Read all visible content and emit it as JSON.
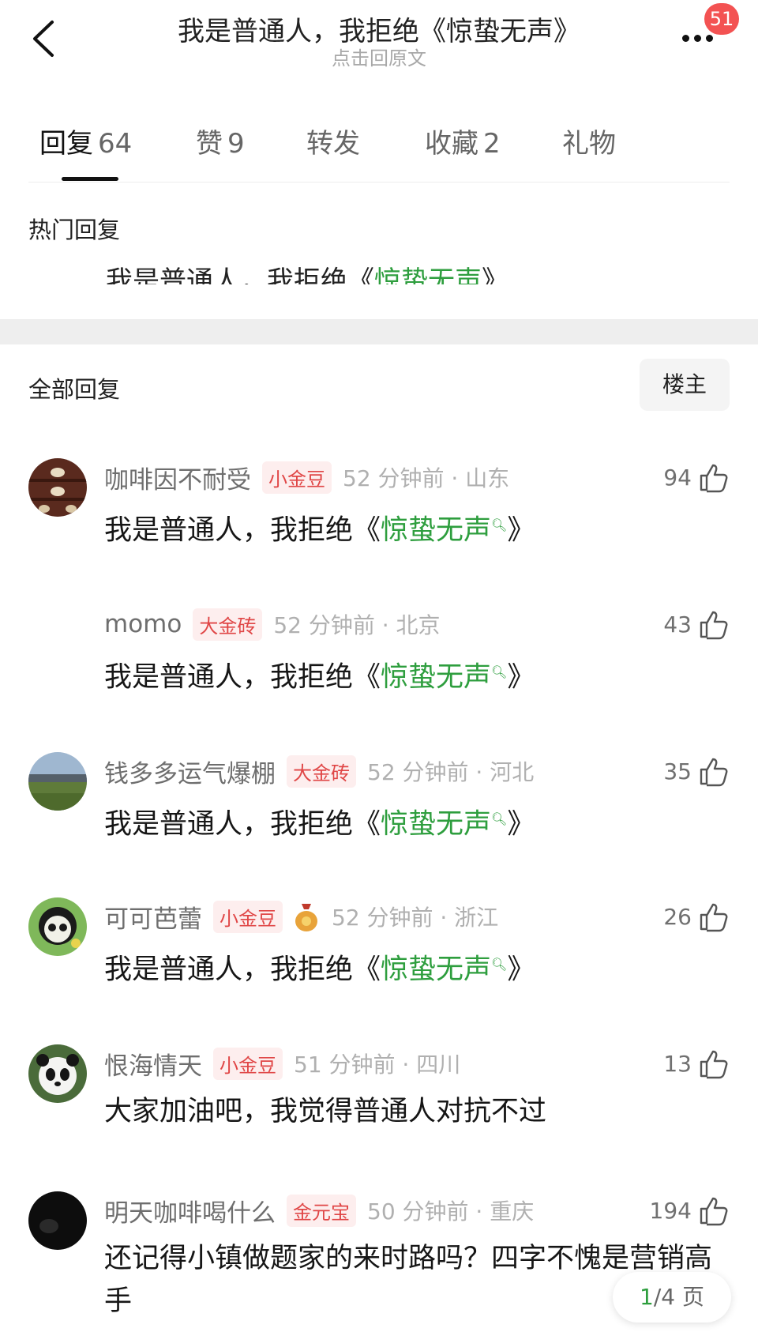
{
  "header": {
    "title": "我是普通人，我拒绝《惊蛰无声》",
    "subtitle": "点击回原文",
    "badge": "51"
  },
  "tabs": [
    {
      "label": "回复",
      "count": "64",
      "active": true
    },
    {
      "label": "赞",
      "count": "9",
      "active": false
    },
    {
      "label": "转发",
      "count": "",
      "active": false
    },
    {
      "label": "收藏",
      "count": "2",
      "active": false
    },
    {
      "label": "礼物",
      "count": "",
      "active": false
    }
  ],
  "hot": {
    "title": "热门回复",
    "preview_prefix": "我是普通人，我拒绝《",
    "preview_link": "惊蛰无声",
    "preview_suffix": "》"
  },
  "all": {
    "title": "全部回复",
    "owner_button": "楼主"
  },
  "comments": [
    {
      "name": "咖啡因不耐受",
      "tag": "小金豆",
      "time": "52 分钟前 · 山东",
      "likes": "94",
      "text_prefix": "我是普通人，我拒绝《",
      "text_link": "惊蛰无声",
      "text_suffix": "》"
    },
    {
      "name": "momo",
      "tag": "大金砖",
      "time": "52 分钟前 · 北京",
      "likes": "43",
      "text_prefix": "我是普通人，我拒绝《",
      "text_link": "惊蛰无声",
      "text_suffix": "》"
    },
    {
      "name": "钱多多运气爆棚",
      "tag": "大金砖",
      "time": "52 分钟前 · 河北",
      "likes": "35",
      "text_prefix": "我是普通人，我拒绝《",
      "text_link": "惊蛰无声",
      "text_suffix": "》"
    },
    {
      "name": "可可芭蕾",
      "tag": "小金豆",
      "time": "52 分钟前 · 浙江",
      "likes": "26",
      "text_prefix": "我是普通人，我拒绝《",
      "text_link": "惊蛰无声",
      "text_suffix": "》"
    },
    {
      "name": "恨海情天",
      "tag": "小金豆",
      "time": "51 分钟前 · 四川",
      "likes": "13",
      "text": "大家加油吧，我觉得普通人对抗不过"
    },
    {
      "name": "明天咖啡喝什么",
      "tag": "金元宝",
      "time": "50 分钟前 · 重庆",
      "likes": "194",
      "text": "还记得小镇做题家的来时路吗？四字不愧是营销高手"
    }
  ],
  "pager": {
    "current": "1",
    "total": "/4 页"
  },
  "colors": {
    "link_green": "#2e9e3e",
    "badge_red": "#f35252",
    "tag_red": "#e04646"
  },
  "icons": {
    "back": "chevron-left-icon",
    "more": "more-dots-icon",
    "like": "thumb-up-icon",
    "search_mark": "search-icon"
  }
}
